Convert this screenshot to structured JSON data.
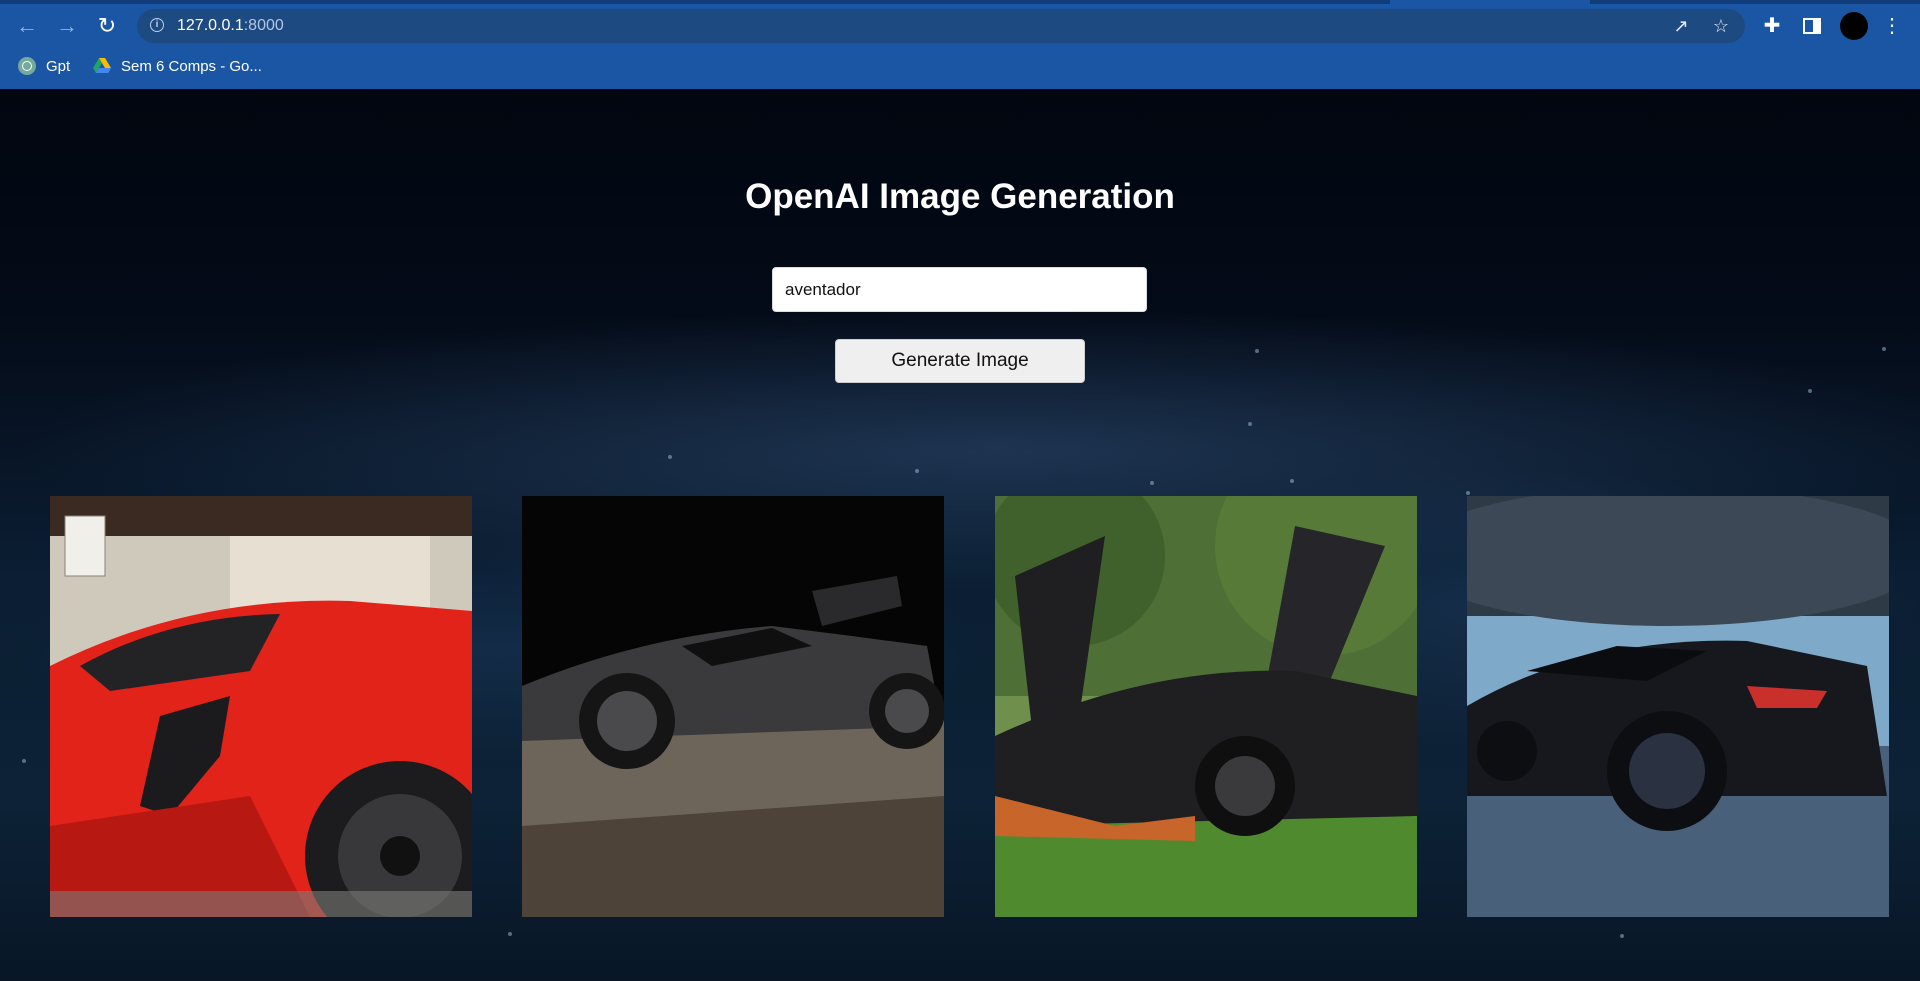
{
  "browser": {
    "url_host": "127.0.0.1",
    "url_port": ":8000",
    "bookmarks": [
      {
        "label": "Gpt",
        "icon": "chatgpt-icon"
      },
      {
        "label": "Sem 6 Comps - Go...",
        "icon": "google-drive-icon"
      }
    ]
  },
  "main": {
    "title": "OpenAI Image Generation",
    "prompt_value": "aventador",
    "generate_label": "Generate Image"
  },
  "images": [
    {
      "icon": "generated-image",
      "colors": {
        "body": "#e2231a",
        "bg": "#c9c3b6"
      }
    },
    {
      "icon": "generated-image",
      "colors": {
        "body": "#3a3a3c",
        "bg": "#050505"
      }
    },
    {
      "icon": "generated-image",
      "colors": {
        "body": "#1f1f22",
        "bg": "#5f8a3e"
      }
    },
    {
      "icon": "generated-image",
      "colors": {
        "body": "#16181d",
        "bg": "#7ea9c9"
      }
    }
  ]
}
